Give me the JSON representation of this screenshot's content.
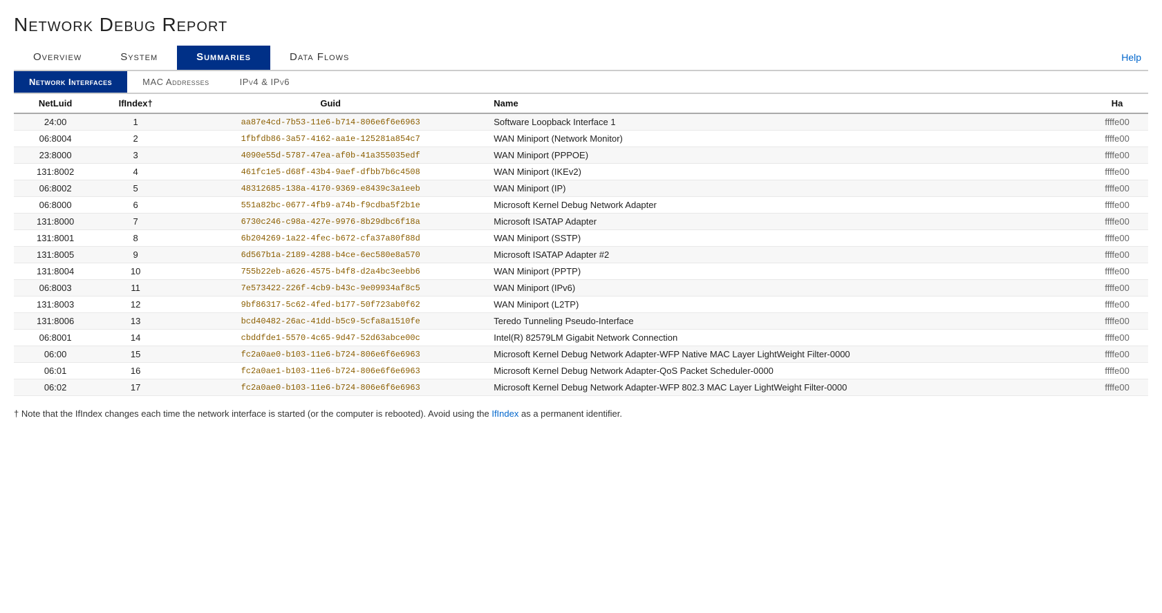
{
  "page": {
    "title": "Network Debug Report",
    "help_label": "Help"
  },
  "main_nav": {
    "items": [
      {
        "label": "Overview",
        "active": false
      },
      {
        "label": "System",
        "active": false
      },
      {
        "label": "Summaries",
        "active": true
      },
      {
        "label": "Data Flows",
        "active": false
      }
    ]
  },
  "sub_nav": {
    "items": [
      {
        "label": "Network Interfaces",
        "active": true
      },
      {
        "label": "MAC Addresses",
        "active": false
      },
      {
        "label": "IPv4 & IPv6",
        "active": false
      }
    ]
  },
  "table": {
    "columns": [
      "NetLuid",
      "IfIndex†",
      "Guid",
      "Name",
      "Ha"
    ],
    "rows": [
      {
        "netluid": "24:00",
        "ifindex": "1",
        "guid": "aa87e4cd-7b53-11e6-b714-806e6f6e6963",
        "name": "Software Loopback Interface 1",
        "ha": "ffffe00"
      },
      {
        "netluid": "06:8004",
        "ifindex": "2",
        "guid": "1fbfdb86-3a57-4162-aa1e-125281a854c7",
        "name": "WAN Miniport (Network Monitor)",
        "ha": "ffffe00"
      },
      {
        "netluid": "23:8000",
        "ifindex": "3",
        "guid": "4090e55d-5787-47ea-af0b-41a355035edf",
        "name": "WAN Miniport (PPPOE)",
        "ha": "ffffe00"
      },
      {
        "netluid": "131:8002",
        "ifindex": "4",
        "guid": "461fc1e5-d68f-43b4-9aef-dfbb7b6c4508",
        "name": "WAN Miniport (IKEv2)",
        "ha": "ffffe00"
      },
      {
        "netluid": "06:8002",
        "ifindex": "5",
        "guid": "48312685-138a-4170-9369-e8439c3a1eeb",
        "name": "WAN Miniport (IP)",
        "ha": "ffffe00"
      },
      {
        "netluid": "06:8000",
        "ifindex": "6",
        "guid": "551a82bc-0677-4fb9-a74b-f9cdba5f2b1e",
        "name": "Microsoft Kernel Debug Network Adapter",
        "ha": "ffffe00"
      },
      {
        "netluid": "131:8000",
        "ifindex": "7",
        "guid": "6730c246-c98a-427e-9976-8b29dbc6f18a",
        "name": "Microsoft ISATAP Adapter",
        "ha": "ffffe00"
      },
      {
        "netluid": "131:8001",
        "ifindex": "8",
        "guid": "6b204269-1a22-4fec-b672-cfa37a80f88d",
        "name": "WAN Miniport (SSTP)",
        "ha": "ffffe00"
      },
      {
        "netluid": "131:8005",
        "ifindex": "9",
        "guid": "6d567b1a-2189-4288-b4ce-6ec580e8a570",
        "name": "Microsoft ISATAP Adapter #2",
        "ha": "ffffe00"
      },
      {
        "netluid": "131:8004",
        "ifindex": "10",
        "guid": "755b22eb-a626-4575-b4f8-d2a4bc3eebb6",
        "name": "WAN Miniport (PPTP)",
        "ha": "ffffe00"
      },
      {
        "netluid": "06:8003",
        "ifindex": "11",
        "guid": "7e573422-226f-4cb9-b43c-9e09934af8c5",
        "name": "WAN Miniport (IPv6)",
        "ha": "ffffe00"
      },
      {
        "netluid": "131:8003",
        "ifindex": "12",
        "guid": "9bf86317-5c62-4fed-b177-50f723ab0f62",
        "name": "WAN Miniport (L2TP)",
        "ha": "ffffe00"
      },
      {
        "netluid": "131:8006",
        "ifindex": "13",
        "guid": "bcd40482-26ac-41dd-b5c9-5cfa8a1510fe",
        "name": "Teredo Tunneling Pseudo-Interface",
        "ha": "ffffe00"
      },
      {
        "netluid": "06:8001",
        "ifindex": "14",
        "guid": "cbddfde1-5570-4c65-9d47-52d63abce00c",
        "name": "Intel(R) 82579LM Gigabit Network Connection",
        "ha": "ffffe00"
      },
      {
        "netluid": "06:00",
        "ifindex": "15",
        "guid": "fc2a0ae0-b103-11e6-b724-806e6f6e6963",
        "name": "Microsoft Kernel Debug Network Adapter-WFP Native MAC Layer LightWeight Filter-0000",
        "ha": "ffffe00"
      },
      {
        "netluid": "06:01",
        "ifindex": "16",
        "guid": "fc2a0ae1-b103-11e6-b724-806e6f6e6963",
        "name": "Microsoft Kernel Debug Network Adapter-QoS Packet Scheduler-0000",
        "ha": "ffffe00"
      },
      {
        "netluid": "06:02",
        "ifindex": "17",
        "guid": "fc2a0ae0-b103-11e6-b724-806e6f6e6963",
        "name": "Microsoft Kernel Debug Network Adapter-WFP 802.3 MAC Layer LightWeight Filter-0000",
        "ha": "ffffe00"
      }
    ]
  },
  "footnote": "† Note that the IfIndex changes each time the network interface is started (or the computer is rebooted). Avoid using the IfIndex as a permanent identifier."
}
